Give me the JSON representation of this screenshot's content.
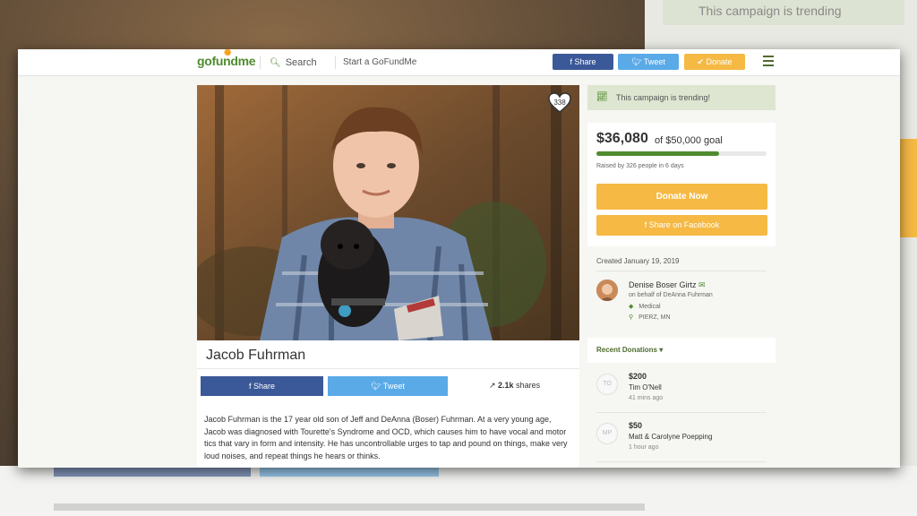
{
  "background": {
    "banner": "This campaign is trending"
  },
  "topbar": {
    "logo": "gofundme",
    "search_label": "Search",
    "start_label": "Start a GoFundMe",
    "share_label": "Share",
    "tweet_label": "Tweet",
    "donate_label": "Donate"
  },
  "campaign": {
    "heart_count": "338",
    "name": "Jacob Fuhrman",
    "share_label": "Share",
    "tweet_label": "Tweet",
    "shares": "2.1k",
    "shares_suffix": "shares",
    "description": "Jacob Fuhrman is the 17 year old son of Jeff and DeAnna (Boser) Fuhrman. At a very young age, Jacob was diagnosed with Tourette's Syndrome and OCD, which causes him to have vocal and motor tics that vary in form and intensity. He has uncontrollable urges to tap and pound on things, make very loud noises, and repeat things he hears or thinks."
  },
  "sidebar": {
    "trending": "This campaign is trending!",
    "amount": "$36,080",
    "goal": "of $50,000 goal",
    "progress": 0.72,
    "raised_by": "Raised by 326 people in 6 days",
    "donate_now": "Donate Now",
    "share_facebook": "Share on Facebook",
    "created": "Created January 19, 2019",
    "organizer": "Denise Boser Girtz",
    "on_behalf": "on behalf of DeAnna Fuhrman",
    "category": "Medical",
    "location": "PIERZ, MN",
    "recent_donations": "Recent Donations",
    "donations": [
      {
        "initials": "TO",
        "amount": "$200",
        "name": "Tim O'Nell",
        "time": "41 mins ago"
      },
      {
        "initials": "MP",
        "amount": "$50",
        "name": "Matt & Carolyne Poepping",
        "time": "1 hour ago"
      }
    ]
  },
  "colors": {
    "brand_green": "#4f8c2f",
    "facebook": "#3b5998",
    "twitter": "#5aaae8",
    "donate": "#f5b944"
  }
}
